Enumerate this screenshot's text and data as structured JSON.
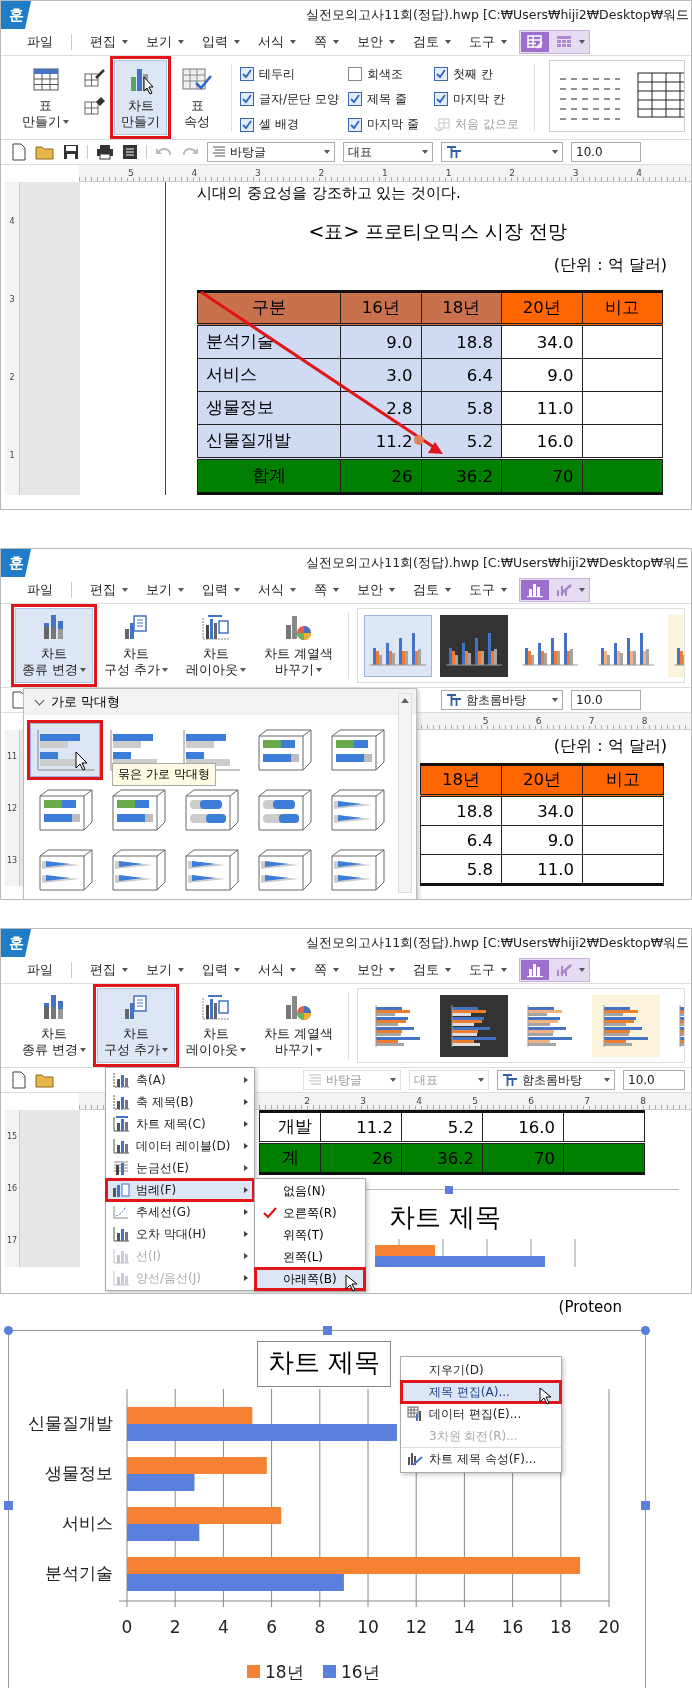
{
  "screens": [
    {
      "kind": "table_tools",
      "app_badge": "훈",
      "title": "실전모의고사11회(정답).hwp [C:₩Users₩hiji2₩Desktop₩워드",
      "menu": [
        {
          "label": "파일",
          "has_caret": false
        },
        {
          "label": "편집",
          "has_caret": true
        },
        {
          "label": "보기",
          "has_caret": true
        },
        {
          "label": "입력",
          "has_caret": true
        },
        {
          "label": "서식",
          "has_caret": true
        },
        {
          "label": "쪽",
          "has_caret": true
        },
        {
          "label": "보안",
          "has_caret": true
        },
        {
          "label": "검토",
          "has_caret": true
        },
        {
          "label": "도구",
          "has_caret": true
        }
      ],
      "tool_tabs": [
        {
          "kind": "table_style",
          "selected": true
        },
        {
          "kind": "table_grid",
          "selected": false
        }
      ],
      "ribbon": {
        "buttons": [
          {
            "kind": "table",
            "label_lines": [
              "표",
              "만들기"
            ],
            "has_caret": true,
            "selected": false
          },
          {
            "kind": "chart",
            "label_lines": [
              "차트",
              "만들기"
            ],
            "has_caret": false,
            "selected": true
          },
          {
            "kind": "table_props",
            "label_lines": [
              "표",
              "속성"
            ],
            "has_caret": false,
            "selected": false
          }
        ],
        "options": [
          {
            "kind": "checkbox",
            "label": "테두리",
            "checked": true,
            "disabled": false
          },
          {
            "kind": "checkbox",
            "label": "회색조",
            "checked": false,
            "disabled": false
          },
          {
            "kind": "checkbox",
            "label": "첫째 칸",
            "checked": true,
            "disabled": false
          },
          {
            "kind": "checkbox",
            "label": "글자/문단 모양",
            "checked": true,
            "disabled": false
          },
          {
            "kind": "checkbox",
            "label": "제목 줄",
            "checked": true,
            "disabled": false
          },
          {
            "kind": "checkbox",
            "label": "마지막 칸",
            "checked": true,
            "disabled": false
          },
          {
            "kind": "checkbox",
            "label": "셀 배경",
            "checked": true,
            "disabled": false
          },
          {
            "kind": "checkbox",
            "label": "마지막 줄",
            "checked": true,
            "disabled": false
          },
          {
            "kind": "action",
            "label": "처음 값으로",
            "disabled": true
          }
        ]
      },
      "toolbar": [
        {
          "kind": "style",
          "value": "바탕글",
          "disabled": false
        },
        {
          "kind": "outline",
          "value": "대표",
          "disabled": false
        },
        {
          "kind": "font",
          "disabled": false
        },
        {
          "kind": "size",
          "value": "10.0",
          "disabled": false
        }
      ],
      "ruler": [
        "5",
        "4",
        "3",
        "2",
        "1",
        "1",
        "2",
        "3",
        "4"
      ],
      "v_ruler": [
        "4",
        "3",
        "2",
        "1"
      ],
      "lead_text": "시대의 중요성을 강조하고 있는 것이다.",
      "table_title": "<표> 프로티오믹스 시장 전망",
      "unit": "(단위 : 억 달러)",
      "table": {
        "columns": [
          {
            "label": "구분",
            "selected": true
          },
          {
            "label": "16년",
            "selected": true
          },
          {
            "label": "18년",
            "selected": true
          },
          {
            "label": "20년",
            "selected": false
          },
          {
            "label": "비고",
            "selected": false
          }
        ],
        "rows": [
          {
            "kind": "body",
            "cells": [
              "분석기술",
              "9.0",
              "18.8",
              "34.0"
            ]
          },
          {
            "kind": "body",
            "cells": [
              "서비스",
              "3.0",
              "6.4",
              "9.0"
            ]
          },
          {
            "kind": "body",
            "cells": [
              "생물정보",
              "2.8",
              "5.8",
              "11.0"
            ]
          },
          {
            "kind": "body",
            "cells": [
              "신물질개발",
              "11.2",
              "5.2",
              "16.0"
            ]
          },
          {
            "kind": "total",
            "cells": [
              "합계",
              "26",
              "36.2",
              "70"
            ]
          }
        ]
      }
    },
    {
      "kind": "chart_type_gallery",
      "app_badge": "훈",
      "title": "실전모의고사11회(정답).hwp [C:₩Users₩hiji2₩Desktop₩워드",
      "menu": [
        {
          "label": "파일",
          "has_caret": false
        },
        {
          "label": "편집",
          "has_caret": true
        },
        {
          "label": "보기",
          "has_caret": true
        },
        {
          "label": "입력",
          "has_caret": true
        },
        {
          "label": "서식",
          "has_caret": true
        },
        {
          "label": "쪽",
          "has_caret": true
        },
        {
          "label": "보안",
          "has_caret": true
        },
        {
          "label": "검토",
          "has_caret": true
        },
        {
          "label": "도구",
          "has_caret": true
        }
      ],
      "tool_tabs": [
        {
          "kind": "chart_bars",
          "selected": true
        },
        {
          "kind": "chart_pen",
          "selected": false
        }
      ],
      "ribbon": {
        "buttons": [
          {
            "kind": "chart_type",
            "label_lines": [
              "차트",
              "종류 변경"
            ],
            "has_caret": true,
            "selected": true
          },
          {
            "kind": "chart_parts",
            "label_lines": [
              "차트",
              "구성 추가"
            ],
            "has_caret": true,
            "selected": false
          },
          {
            "kind": "chart_layout",
            "label_lines": [
              "차트",
              "레이아웃"
            ],
            "has_caret": true,
            "selected": false
          },
          {
            "kind": "chart_colors",
            "label_lines": [
              "차트 계열색",
              "바꾸기"
            ],
            "has_caret": true,
            "selected": false
          }
        ],
        "styles": [
          {
            "kind": "light",
            "selected": true
          },
          {
            "kind": "dark",
            "selected": false
          },
          {
            "kind": "light",
            "selected": false
          },
          {
            "kind": "pale",
            "selected": false
          },
          {
            "kind": "cream",
            "selected": false
          }
        ]
      },
      "gallery": {
        "heading": "가로 막대형",
        "tooltip": "묶은 가로 막대형",
        "items": [
          {
            "kind": "flat",
            "selected": true
          },
          {
            "kind": "flat",
            "selected": false
          },
          {
            "kind": "flat",
            "selected": false
          },
          {
            "kind": "box",
            "selected": false
          },
          {
            "kind": "box",
            "selected": false
          },
          {
            "kind": "box",
            "selected": false
          },
          {
            "kind": "box",
            "selected": false
          },
          {
            "kind": "cylinder",
            "selected": false
          },
          {
            "kind": "cylinder",
            "selected": false
          },
          {
            "kind": "cone",
            "selected": false
          },
          {
            "kind": "cone",
            "selected": false
          },
          {
            "kind": "cone",
            "selected": false
          },
          {
            "kind": "cone",
            "selected": false
          },
          {
            "kind": "cone",
            "selected": false
          },
          {
            "kind": "cone",
            "selected": false
          }
        ]
      },
      "toolbar": [
        {
          "kind": "font",
          "value": "함초롬바탕",
          "disabled": false
        },
        {
          "kind": "size",
          "value": "10.0",
          "disabled": false
        }
      ],
      "ruler": [
        "5",
        "6",
        "7",
        "8"
      ],
      "v_ruler": [
        "11",
        "12",
        "13"
      ],
      "unit": "(단위 : 억 달러)",
      "table": {
        "columns": [
          {
            "label": "18년",
            "selected": false
          },
          {
            "label": "20년",
            "selected": false
          },
          {
            "label": "비고",
            "selected": false
          }
        ],
        "rows": [
          {
            "cells": [
              "18.8",
              "34.0"
            ]
          },
          {
            "cells": [
              "6.4",
              "9.0"
            ]
          },
          {
            "cells": [
              "5.8",
              "11.0"
            ]
          }
        ]
      }
    },
    {
      "kind": "chart_parts_menu",
      "app_badge": "훈",
      "title": "실전모의고사11회(정답).hwp [C:₩Users₩hiji2₩Desktop₩워드",
      "menu": [
        {
          "label": "파일",
          "has_caret": false
        },
        {
          "label": "편집",
          "has_caret": true
        },
        {
          "label": "보기",
          "has_caret": true
        },
        {
          "label": "입력",
          "has_caret": true
        },
        {
          "label": "서식",
          "has_caret": true
        },
        {
          "label": "쪽",
          "has_caret": true
        },
        {
          "label": "보안",
          "has_caret": true
        },
        {
          "label": "검토",
          "has_caret": true
        },
        {
          "label": "도구",
          "has_caret": true
        }
      ],
      "tool_tabs": [
        {
          "kind": "chart_bars",
          "selected": true
        },
        {
          "kind": "chart_pen",
          "selected": false
        }
      ],
      "ribbon": {
        "buttons": [
          {
            "kind": "chart_type",
            "label_lines": [
              "차트",
              "종류 변경"
            ],
            "has_caret": true,
            "selected": false
          },
          {
            "kind": "chart_parts",
            "label_lines": [
              "차트",
              "구성 추가"
            ],
            "has_caret": true,
            "selected": true
          },
          {
            "kind": "chart_layout",
            "label_lines": [
              "차트",
              "레이아웃"
            ],
            "has_caret": true,
            "selected": false
          },
          {
            "kind": "chart_colors",
            "label_lines": [
              "차트 계열색",
              "바꾸기"
            ],
            "has_caret": true,
            "selected": false
          }
        ],
        "styles": [
          {
            "kind": "light",
            "selected": false
          },
          {
            "kind": "dark",
            "selected": false
          },
          {
            "kind": "pale",
            "selected": false
          },
          {
            "kind": "cream",
            "selected": false
          },
          {
            "kind": "light",
            "selected": false
          }
        ]
      },
      "toolbar": [
        {
          "kind": "style",
          "value": "바탕글",
          "disabled": true
        },
        {
          "kind": "outline",
          "value": "대표",
          "disabled": true
        },
        {
          "kind": "font",
          "value": "함초롬바탕",
          "disabled": false
        },
        {
          "kind": "size",
          "value": "10.0",
          "disabled": false
        }
      ],
      "ruler": [
        "2",
        "3",
        "4",
        "5",
        "6",
        "7",
        "8"
      ],
      "v_ruler": [
        "15",
        "16",
        "17"
      ],
      "table": {
        "rows": [
          {
            "kind": "body",
            "cells": [
              "개발",
              "11.2",
              "5.2",
              "16.0"
            ]
          },
          {
            "kind": "total",
            "cells": [
              "계",
              "26",
              "36.2",
              "70"
            ]
          }
        ]
      },
      "chart_title": "차트 제목",
      "parts_menu": [
        {
          "kind": "axis",
          "label": "축(A)",
          "disabled": false,
          "selected": false
        },
        {
          "kind": "axis_title",
          "label": "축 제목(B)",
          "disabled": false,
          "selected": false
        },
        {
          "kind": "chart_title",
          "label": "차트 제목(C)",
          "disabled": false,
          "selected": false
        },
        {
          "kind": "data_label",
          "label": "데이터 레이블(D)",
          "disabled": false,
          "selected": false
        },
        {
          "kind": "gridline",
          "label": "눈금선(E)",
          "disabled": false,
          "selected": false
        },
        {
          "kind": "legend",
          "label": "범례(F)",
          "disabled": false,
          "selected": true
        },
        {
          "kind": "trendline",
          "label": "추세선(G)",
          "disabled": false,
          "selected": false
        },
        {
          "kind": "error_bar",
          "label": "오차 막대(H)",
          "disabled": false,
          "selected": false
        },
        {
          "kind": "line",
          "label": "선(I)",
          "disabled": true,
          "selected": false
        },
        {
          "kind": "updown",
          "label": "양선/음선(J)",
          "disabled": true,
          "selected": false
        }
      ],
      "submenu": [
        {
          "label": "없음(N)",
          "checked": false,
          "selected": false
        },
        {
          "label": "오른쪽(R)",
          "checked": true,
          "selected": false
        },
        {
          "label": "위쪽(T)",
          "checked": false,
          "selected": false
        },
        {
          "label": "왼쪽(L)",
          "checked": false,
          "selected": false
        },
        {
          "label": "아래쪽(B)",
          "checked": false,
          "selected": true
        }
      ]
    },
    {
      "kind": "chart_context_menu",
      "side_text": "(Proteon",
      "chart": {
        "title": "차트 제목",
        "chart_data": {
          "type": "bar",
          "orientation": "horizontal",
          "categories": [
            "신물질개발",
            "생물정보",
            "서비스",
            "분석기술"
          ],
          "series": [
            {
              "name": "18년",
              "color": "#f58232",
              "values": [
                5.2,
                5.8,
                6.4,
                18.8
              ]
            },
            {
              "name": "16년",
              "color": "#5b7fdc",
              "values": [
                11.2,
                2.8,
                3.0,
                9.0
              ]
            }
          ],
          "xlim": [
            0,
            20
          ],
          "xticks": [
            0,
            2,
            4,
            6,
            8,
            10,
            12,
            14,
            16,
            18,
            20
          ],
          "grid": true,
          "legend": true
        }
      },
      "context_menu": [
        {
          "kind": "plain",
          "label": "지우기(D)",
          "disabled": false,
          "selected": false
        },
        {
          "kind": "plain",
          "label": "제목 편집(A)...",
          "disabled": false,
          "selected": true
        },
        {
          "kind": "data",
          "label": "데이터 편집(E)...",
          "disabled": false,
          "selected": false
        },
        {
          "kind": "plain",
          "label": "3차원 회전(R)...",
          "disabled": true,
          "selected": false
        },
        {
          "kind": "props",
          "label": "차트 제목 속성(F)...",
          "disabled": false,
          "selected": false
        }
      ]
    }
  ]
}
